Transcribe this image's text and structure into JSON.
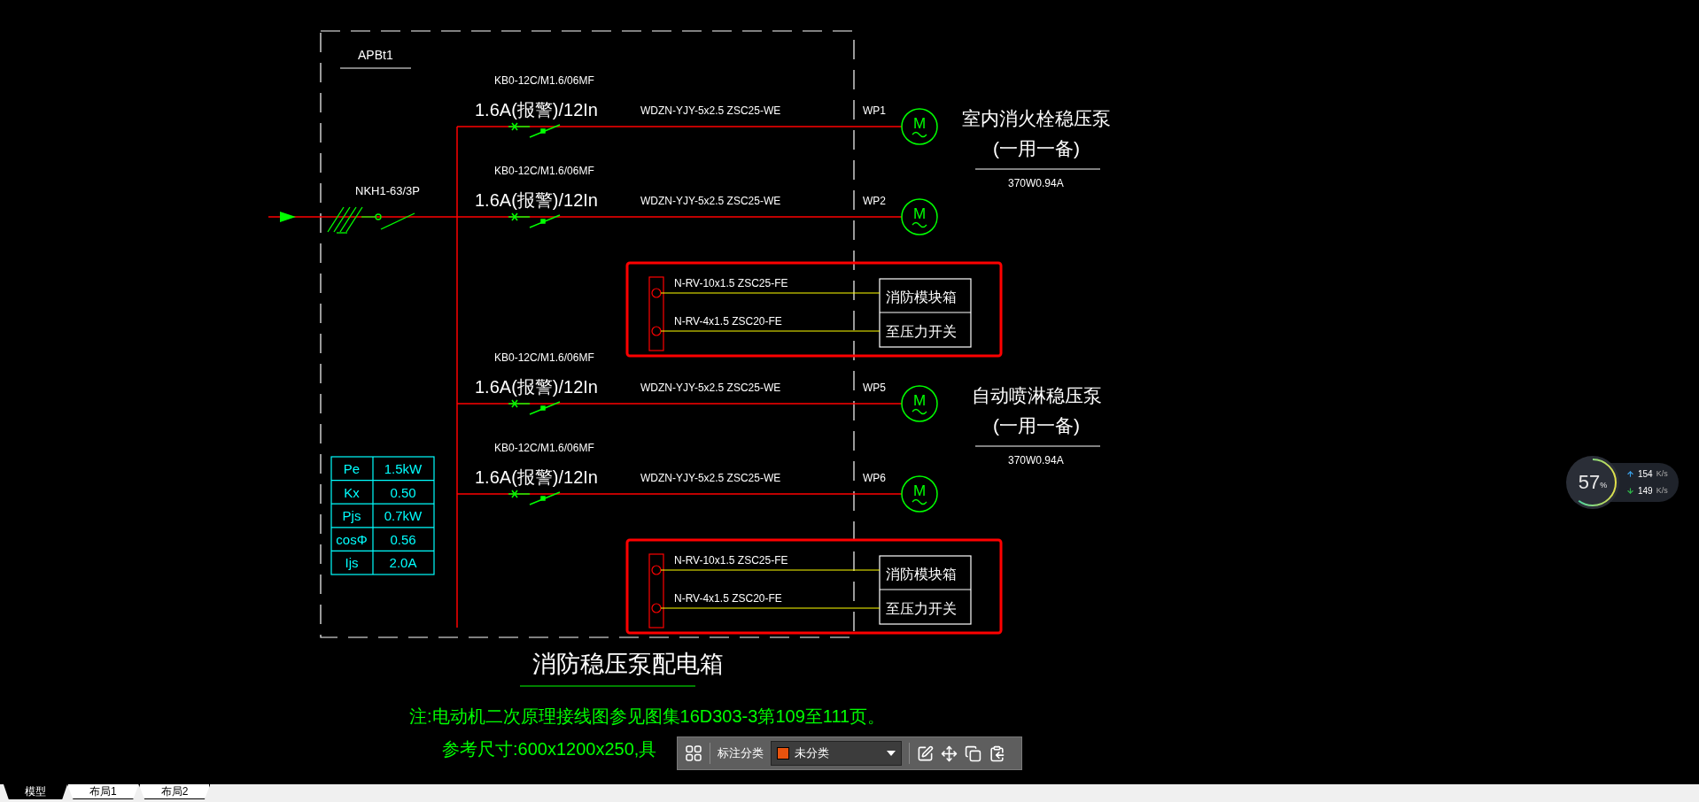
{
  "panel": {
    "name": "APBt1",
    "incoming_breaker": "NKH1-63/3P"
  },
  "items": [
    {
      "kind": "circuit",
      "breaker": "KB0-12C/M1.6/06MF",
      "setting": "1.6A(报警)/12In",
      "cable": "WDZN-YJY-5x2.5 ZSC25-WE",
      "circuit_no": "WP1",
      "motor_symbol": "M",
      "pump": {
        "name": "室内消火栓稳压泵",
        "note": "(一用一备)",
        "rating": "370W0.94A"
      }
    },
    {
      "kind": "circuit",
      "breaker": "KB0-12C/M1.6/06MF",
      "setting": "1.6A(报警)/12In",
      "cable": "WDZN-YJY-5x2.5 ZSC25-WE",
      "circuit_no": "WP2",
      "motor_symbol": "M"
    },
    {
      "kind": "control_group",
      "lines": [
        {
          "cable": "N-RV-10x1.5 ZSC25-FE",
          "target": "消防模块箱"
        },
        {
          "cable": "N-RV-4x1.5 ZSC20-FE",
          "target": "至压力开关"
        }
      ]
    },
    {
      "kind": "circuit",
      "breaker": "KB0-12C/M1.6/06MF",
      "setting": "1.6A(报警)/12In",
      "cable": "WDZN-YJY-5x2.5 ZSC25-WE",
      "circuit_no": "WP5",
      "motor_symbol": "M",
      "pump": {
        "name": "自动喷淋稳压泵",
        "note": "(一用一备)",
        "rating": "370W0.94A"
      }
    },
    {
      "kind": "circuit",
      "breaker": "KB0-12C/M1.6/06MF",
      "setting": "1.6A(报警)/12In",
      "cable": "WDZN-YJY-5x2.5 ZSC25-WE",
      "circuit_no": "WP6",
      "motor_symbol": "M"
    },
    {
      "kind": "control_group",
      "lines": [
        {
          "cable": "N-RV-10x1.5 ZSC25-FE",
          "target": "消防模块箱"
        },
        {
          "cable": "N-RV-4x1.5 ZSC20-FE",
          "target": "至压力开关"
        }
      ]
    }
  ],
  "load_table": [
    {
      "label": "Pe",
      "value": "1.5kW"
    },
    {
      "label": "Kx",
      "value": "0.50"
    },
    {
      "label": "Pjs",
      "value": "0.7kW"
    },
    {
      "label": "cosΦ",
      "value": "0.56"
    },
    {
      "label": "Ijs",
      "value": "2.0A"
    }
  ],
  "title": "消防稳压泵配电箱",
  "notes": [
    "注:电动机二次原理接线图参见图集16D303-3第109至111页。",
    "参考尺寸:600x1200x250,具"
  ],
  "toolbar": {
    "label": "标注分类",
    "category": {
      "name": "未分类",
      "color": "#e8530e"
    }
  },
  "net_monitor": {
    "percent": "57",
    "unit": "%",
    "upload": {
      "value": "154",
      "unit": "K/s"
    },
    "download": {
      "value": "149",
      "unit": "K/s"
    }
  },
  "tabs": [
    {
      "label": "模型",
      "selected": true
    },
    {
      "label": "布局1",
      "selected": false
    },
    {
      "label": "布局2",
      "selected": false
    }
  ]
}
